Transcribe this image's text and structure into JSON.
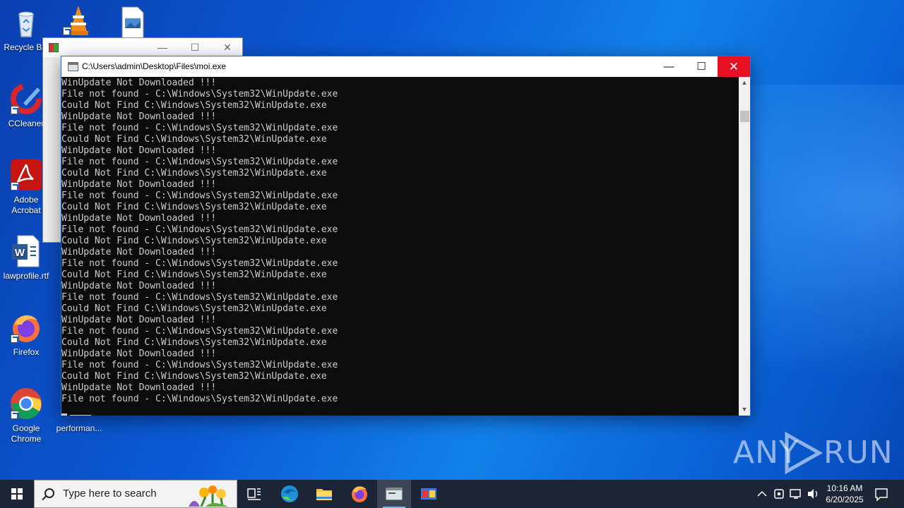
{
  "desktop": {
    "icons": [
      {
        "label": "Recycle Bin",
        "icon": "recycle-bin-icon"
      },
      {
        "label": "CCleaner",
        "icon": "ccleaner-icon"
      },
      {
        "label": "Adobe Acrobat",
        "icon": "adobe-acrobat-icon"
      },
      {
        "label": "lawprofile.rtf",
        "icon": "word-document-icon"
      },
      {
        "label": "Firefox",
        "icon": "firefox-icon"
      },
      {
        "label": "Google Chrome",
        "icon": "chrome-icon"
      },
      {
        "label": "performan...",
        "icon": "file-icon"
      }
    ]
  },
  "console_window": {
    "title": "C:\\Users\\admin\\Desktop\\Files\\moi.exe",
    "minimize_glyph": "—",
    "maximize_glyph": "☐",
    "close_glyph": "✕",
    "lines": [
      "WinUpdate Not Downloaded !!!",
      "File not found - C:\\Windows\\System32\\WinUpdate.exe",
      "Could Not Find C:\\Windows\\System32\\WinUpdate.exe",
      "WinUpdate Not Downloaded !!!",
      "File not found - C:\\Windows\\System32\\WinUpdate.exe",
      "Could Not Find C:\\Windows\\System32\\WinUpdate.exe",
      "WinUpdate Not Downloaded !!!",
      "File not found - C:\\Windows\\System32\\WinUpdate.exe",
      "Could Not Find C:\\Windows\\System32\\WinUpdate.exe",
      "WinUpdate Not Downloaded !!!",
      "File not found - C:\\Windows\\System32\\WinUpdate.exe",
      "Could Not Find C:\\Windows\\System32\\WinUpdate.exe",
      "WinUpdate Not Downloaded !!!",
      "File not found - C:\\Windows\\System32\\WinUpdate.exe",
      "Could Not Find C:\\Windows\\System32\\WinUpdate.exe",
      "WinUpdate Not Downloaded !!!",
      "File not found - C:\\Windows\\System32\\WinUpdate.exe",
      "Could Not Find C:\\Windows\\System32\\WinUpdate.exe",
      "WinUpdate Not Downloaded !!!",
      "File not found - C:\\Windows\\System32\\WinUpdate.exe",
      "Could Not Find C:\\Windows\\System32\\WinUpdate.exe",
      "WinUpdate Not Downloaded !!!",
      "File not found - C:\\Windows\\System32\\WinUpdate.exe",
      "Could Not Find C:\\Windows\\System32\\WinUpdate.exe",
      "WinUpdate Not Downloaded !!!",
      "File not found - C:\\Windows\\System32\\WinUpdate.exe",
      "Could Not Find C:\\Windows\\System32\\WinUpdate.exe",
      "WinUpdate Not Downloaded !!!",
      "File not found - C:\\Windows\\System32\\WinUpdate.exe"
    ]
  },
  "background_window": {
    "minimize_glyph": "—",
    "maximize_glyph": "☐",
    "close_glyph": "✕"
  },
  "watermark": {
    "left": "ANY",
    "right": "RUN"
  },
  "taskbar": {
    "search_placeholder": "Type here to search",
    "apps": [
      "task-view-icon",
      "edge-icon",
      "file-explorer-icon",
      "firefox-icon",
      "console-icon",
      "app-icon"
    ],
    "tray": {
      "chevron": "^",
      "volume": "🔊"
    },
    "clock": {
      "time": "10:16 AM",
      "date": "6/20/2025"
    }
  },
  "colors": {
    "console_bg": "#0c0c0c",
    "console_text": "#cccccc",
    "close_red": "#e81123",
    "taskbar": "#1c2535"
  }
}
